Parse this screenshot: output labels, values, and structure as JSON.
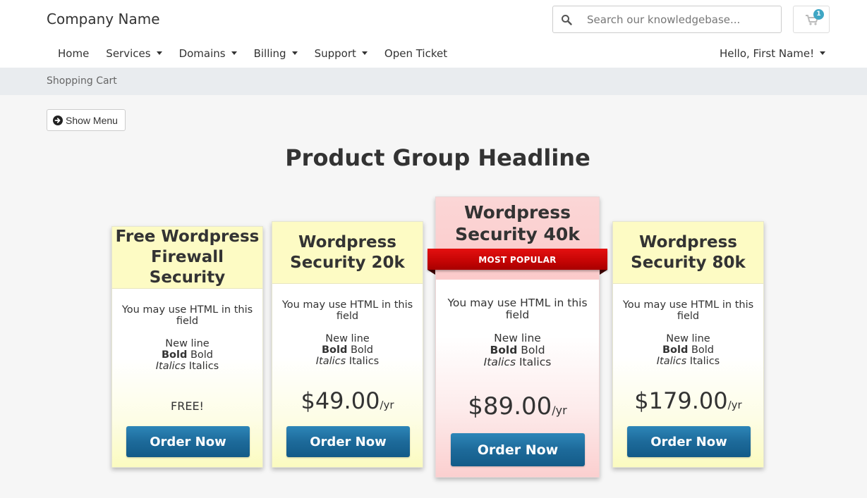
{
  "header": {
    "brand": "Company Name",
    "search_placeholder": "Search our knowledgebase...",
    "cart_count": "1"
  },
  "nav": {
    "items": [
      {
        "label": "Home",
        "dropdown": false
      },
      {
        "label": "Services",
        "dropdown": true
      },
      {
        "label": "Domains",
        "dropdown": true
      },
      {
        "label": "Billing",
        "dropdown": true
      },
      {
        "label": "Support",
        "dropdown": true
      },
      {
        "label": "Open Ticket",
        "dropdown": false
      }
    ],
    "account_label": "Hello, First Name!"
  },
  "breadcrumb": "Shopping Cart",
  "show_menu_label": "Show Menu",
  "headline": "Product Group Headline",
  "products": [
    {
      "title_line1": "Free Wordpress",
      "title_line2": "Firewall Security",
      "desc_line1": "You may use HTML in this field",
      "new_line": "New line",
      "bold_label": "Bold",
      "bold_plain": "Bold",
      "italic_label": "Italics",
      "italic_plain": "Italics",
      "price": "FREE!",
      "period": "",
      "button": "Order Now"
    },
    {
      "title_line1": "Wordpress",
      "title_line2": "Security 20k",
      "desc_line1": "You may use HTML in this field",
      "new_line": "New line",
      "bold_label": "Bold",
      "bold_plain": "Bold",
      "italic_label": "Italics",
      "italic_plain": "Italics",
      "price": "$49.00",
      "period": "/yr",
      "button": "Order Now"
    },
    {
      "title_line1": "Wordpress",
      "title_line2": "Security 40k",
      "ribbon": "MOST POPULAR",
      "desc_line1": "You may use HTML in this field",
      "new_line": "New line",
      "bold_label": "Bold",
      "bold_plain": "Bold",
      "italic_label": "Italics",
      "italic_plain": "Italics",
      "price": "$89.00",
      "period": "/yr",
      "button": "Order Now"
    },
    {
      "title_line1": "Wordpress",
      "title_line2": "Security 80k",
      "desc_line1": "You may use HTML in this field",
      "new_line": "New line",
      "bold_label": "Bold",
      "bold_plain": "Bold",
      "italic_label": "Italics",
      "italic_plain": "Italics",
      "price": "$179.00",
      "period": "/yr",
      "button": "Order Now"
    }
  ],
  "colors": {
    "header_bg": "#ffffff",
    "breadcrumb_bg": "#e9ecef",
    "card_head": "#fdfbc4",
    "featured_head": "#fbcaca",
    "button": "#1d6a9a",
    "ribbon": "#c40404",
    "badge": "#3fa6c4"
  }
}
